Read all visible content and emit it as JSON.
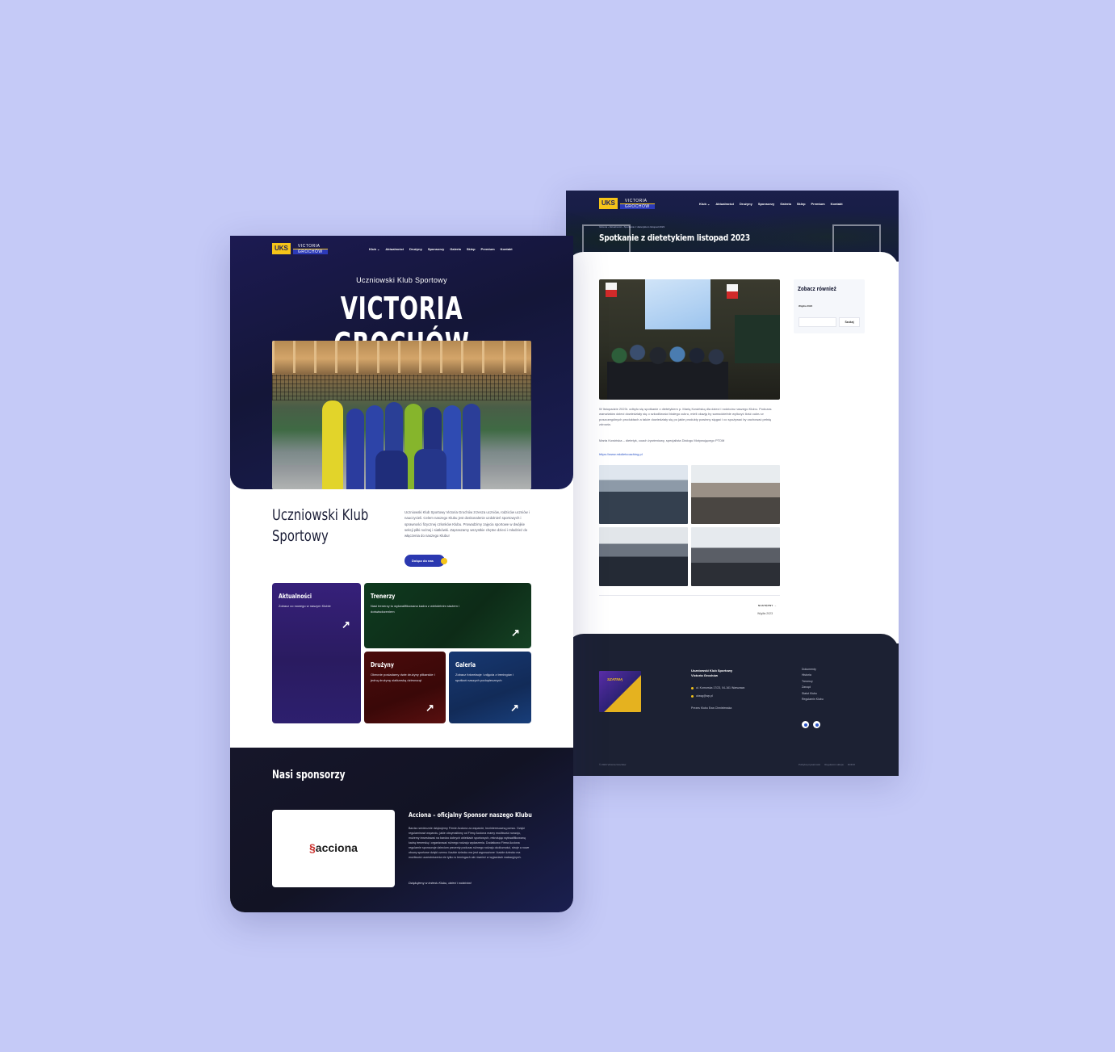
{
  "brand": {
    "uks": "UKS",
    "line1": "VICTORIA",
    "line2": "GROCHÓW"
  },
  "nav": [
    "Klub ⌄",
    "Aktualności",
    "Drużyny",
    "Sponsorzy",
    "Galeria",
    "Sklep",
    "Premium",
    "Kontakt"
  ],
  "home": {
    "pretitle": "Uczniowski Klub Sportowy",
    "title": "VICTORIA GROCHÓW",
    "intro_title": "Uczniowski Klub Sportowy",
    "intro_text": "Uczniowski Klub Sportowy Victoria Grochów zrzesza uczniów, rodziców uczniów i nauczycieli. Celem naszego Klubu jest doskonalenie uzdolnień sportowych i sprawności fizycznej członków Klubu. Prowadzimy zajęcia sportowe w dwójkie sekcji piłki nożnej i siatkówki. Zapraszamy wszystkie chętne dzieci i młodzież do włączenia do naszego Klubu!",
    "cta": "Dołącz do nas",
    "tiles": [
      {
        "title": "Aktualności",
        "text": "Zobacz co nowego w naszym Klubie"
      },
      {
        "title": "Trenerzy",
        "text": "Nasi trenerzy to wykwalifikowana kadra z wieloletnim stażem i doświadczeniem"
      },
      {
        "title": "Drużyny",
        "text": "Obecnie posiadamy dwie drużyny piłkarskie i jedną drużynę siatkarską dziewcząt"
      },
      {
        "title": "Galeria",
        "text": "Zobacz fotorelacje i zdjęcia z treningów i spotkań naszych podopiecznych"
      }
    ],
    "sponsors_title": "Nasi sponsorzy",
    "sponsor_logo": "acciona",
    "sponsor_heading": "Acciona – oficjalny Sponsor naszego Klubu",
    "sponsor_text": "Bardzo serdecznie dziękujemy Firmie Acciona za wsparcie, bezinteresowną pomoc. Dzięki regulaminowi wsparciu, jakie otrzymaliśmy od Firmy Acciona mamy możliwość rozwoju, możemy inwestować na bardzo dobrych obiektach sportowych, rekrutując wykwalifikowaną kadrą trenerską i organizować różnego rodzaju wydarzenia. Dodatkowo Firma Acciona regularnie sponsoruje dzieciom prezenty podczas różnego rodzaju okoliczności, stroje a nowe obuwy sportowe dzięki czemu i każde dziecko ma jest wyposażone i każde dziecko ma możliwość uczestniczenia nie tylko w treningach ale również w wyjazdach wakacyjnych.",
    "sponsor_thanks": "Dziękujemy w imieniu Klubu, dzieci i rodziców!"
  },
  "article": {
    "breadcrumb": "Główna  ›  Aktualności  ›  Spotkanie z dietetykiem listopad 2023",
    "title": "Spotkanie z dietetykiem listopad 2023",
    "para1": "W listopadzie 2023r. odbyło się spotkanie z dietetykiem p. Marią Kowińską dla dzieci i rodziców naszego Klubu. Podczas warsztatów dzieci dowiedziały się o szkodliwości białego cukru, mieli okazję by samodzielnie wyliczyć ilość cukru w poszczególnych produktach a także dowiedziały się po jakie produkty powinny sięgać i co spożywać by zachować pełnię zdrowia.",
    "para2": "Marta Kowińska – dietetyk, coach żywieniowy, specjalista Dialogu Motywującego PTDM",
    "link": "https://www.mkdietcoaching.pl",
    "next_label": "NASTĘPNY →",
    "next_title": "Wigilia 2023",
    "sidebar_title": "Zobacz również",
    "sidebar_link": "Wigilia 2023",
    "search_button": "Szukaj"
  },
  "footer": {
    "badge": "SZATNIĄ",
    "club_line1": "Uczniowski Klub Sportowy",
    "club_line2": "Victoria Grochów",
    "address": "ul. Komorska 17/23, 04-161 Warszawa",
    "email": "ukssg@wp.pl",
    "president": "Prezes Klubu Ewa Chmielewska",
    "menu": [
      "Dokumenty",
      "Historia",
      "Trenerzy",
      "Zarząd",
      "Statut Klubu",
      "Regulamin Klubu"
    ],
    "copyright": "© 2024 Victoria Grochów",
    "legal": [
      "Polityka prywatności",
      "Regulamin sklepu",
      "RODO"
    ]
  }
}
